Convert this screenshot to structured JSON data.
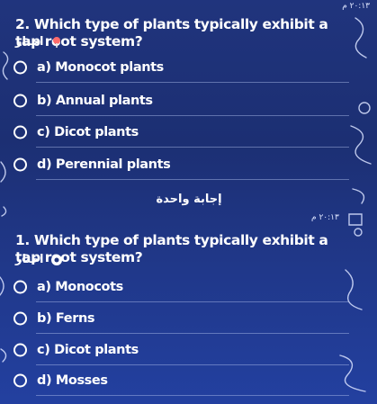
{
  "header": {
    "time": "٢٠:١٣ م"
  },
  "question2": {
    "text": "2. Which type of plants typically exhibit a tap root system?",
    "choose_label": "اختار",
    "options": [
      "a) Monocot plants",
      "b) Annual plants",
      "c) Dicot plants",
      "d) Perennial plants"
    ]
  },
  "answer_button_label": "إجابة واحدة",
  "question1": {
    "time": "٢٠:١٣ م",
    "text": "1. Which type of plants typically exhibit a tap root system?",
    "choose_label": "اختار",
    "options": [
      "a) Monocots",
      "b) Ferns",
      "c) Dicot plants",
      "d) Mosses"
    ]
  },
  "colors": {
    "background": "#20347d",
    "divider": "#b4c3f0",
    "text": "#ffffff",
    "choose_icon_q2": "#ff6b6b",
    "choose_icon_q1": "#ffffff"
  },
  "icons": {
    "choose_icon_q2": "pin-icon",
    "choose_icon_q1": "circle-check-icon"
  }
}
